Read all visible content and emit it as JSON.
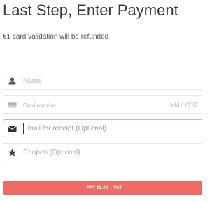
{
  "header": {
    "title": "Last Step, Enter Payment",
    "subtitle": "€1 card validation will be refunded"
  },
  "form": {
    "name": {
      "placeholder": "Name",
      "icon": "user-icon"
    },
    "card": {
      "placeholder": "Card number",
      "expiry_placeholder": "MM / YY  C",
      "icon": "credit-card-icon"
    },
    "email": {
      "placeholder": "Email for receipt (Optional)",
      "icon": "envelope-icon"
    },
    "coupon": {
      "placeholder": "Coupon (Optional)",
      "icon": "star-icon"
    }
  },
  "pay_button": {
    "label": "PAY €1.00 + VAT"
  },
  "colors": {
    "accent": "#ee6a65",
    "focus_border": "#9fc2e6",
    "field_border": "#e6e6e6",
    "placeholder": "#b5b5b5",
    "title": "#3a3a3a"
  }
}
